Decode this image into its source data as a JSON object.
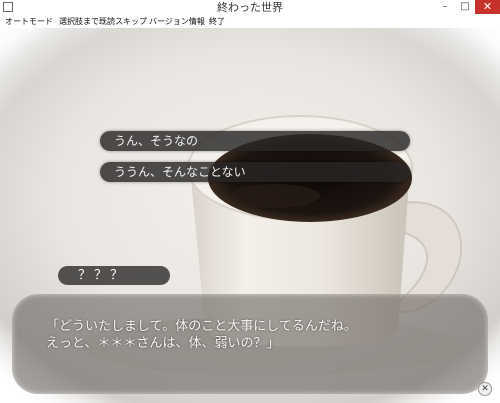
{
  "window": {
    "title": "終わった世界",
    "minimize_glyph": "–",
    "maximize_glyph": "□",
    "close_glyph": "✕"
  },
  "menu": {
    "items": [
      "オートモード",
      "選択肢まで既読スキップ",
      "バージョン情報",
      "終了"
    ]
  },
  "choices": [
    {
      "label": "うん、そうなの"
    },
    {
      "label": "ううん、そんなことない"
    }
  ],
  "dialogue": {
    "speaker": "？？？",
    "lines": [
      "「どういたしまして。体のこと大事にしてるんだね。",
      "えっと、＊＊＊さんは、体、弱いの？」"
    ]
  },
  "controls": {
    "close_icon_glyph": "✕"
  },
  "colors": {
    "close_button": "#c7312b",
    "coffee": "#1c1410",
    "mug": "#f1ede6"
  }
}
